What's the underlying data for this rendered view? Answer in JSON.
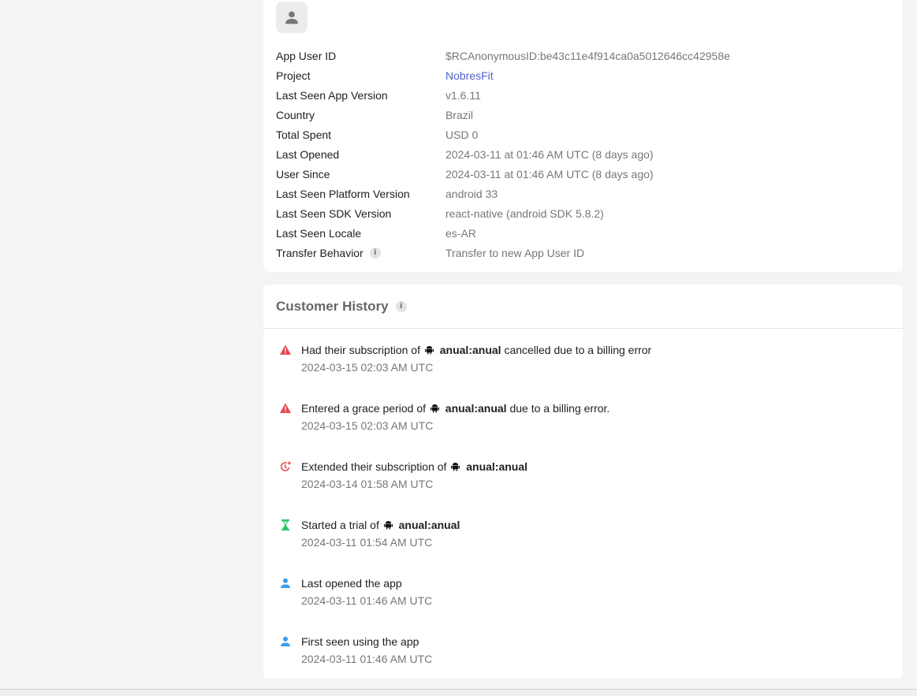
{
  "customer_info": {
    "rows": [
      {
        "label": "App User ID",
        "value": "$RCAnonymousID:be43c11e4f914ca0a5012646cc42958e"
      },
      {
        "label": "Project",
        "value": "NobresFit"
      },
      {
        "label": "Last Seen App Version",
        "value": "v1.6.11"
      },
      {
        "label": "Country",
        "value": "Brazil"
      },
      {
        "label": "Total Spent",
        "value": "USD 0"
      },
      {
        "label": "Last Opened",
        "value": "2024-03-11 at 01:46 AM UTC (8 days ago)"
      },
      {
        "label": "User Since",
        "value": "2024-03-11 at 01:46 AM UTC (8 days ago)"
      },
      {
        "label": "Last Seen Platform Version",
        "value": "android 33"
      },
      {
        "label": "Last Seen SDK Version",
        "value": "react-native (android SDK 5.8.2)"
      },
      {
        "label": "Last Seen Locale",
        "value": "es-AR"
      },
      {
        "label": "Transfer Behavior",
        "value": "Transfer to new App User ID"
      }
    ],
    "info_glyph": "i"
  },
  "history": {
    "title": "Customer History",
    "info_glyph": "i",
    "events": [
      {
        "icon": "warning-icon",
        "color": "#e5484d",
        "pre": "Had their subscription of",
        "product": "anual:anual",
        "post": "cancelled due to a billing error",
        "time": "2024-03-15 02:03 AM UTC"
      },
      {
        "icon": "warning-icon",
        "color": "#e5484d",
        "pre": "Entered a grace period of",
        "product": "anual:anual",
        "post": "due to a billing error.",
        "time": "2024-03-15 02:03 AM UTC"
      },
      {
        "icon": "extend-clock-icon",
        "color": "#e5484d",
        "pre": "Extended their subscription of",
        "product": "anual:anual",
        "post": "",
        "time": "2024-03-14 01:58 AM UTC"
      },
      {
        "icon": "hourglass-icon",
        "color": "#22c55e",
        "pre": "Started a trial of",
        "product": "anual:anual",
        "post": "",
        "time": "2024-03-11 01:54 AM UTC"
      },
      {
        "icon": "user-icon",
        "color": "#3b9ded",
        "pre": "Last opened the app",
        "product": "",
        "post": "",
        "time": "2024-03-11 01:46 AM UTC"
      },
      {
        "icon": "user-icon",
        "color": "#3b9ded",
        "pre": "First seen using the app",
        "product": "",
        "post": "",
        "time": "2024-03-11 01:46 AM UTC"
      }
    ]
  },
  "colors": {
    "link": "#5361cf",
    "warning": "#e5484d",
    "trial": "#22c55e",
    "user": "#3b9ded"
  }
}
